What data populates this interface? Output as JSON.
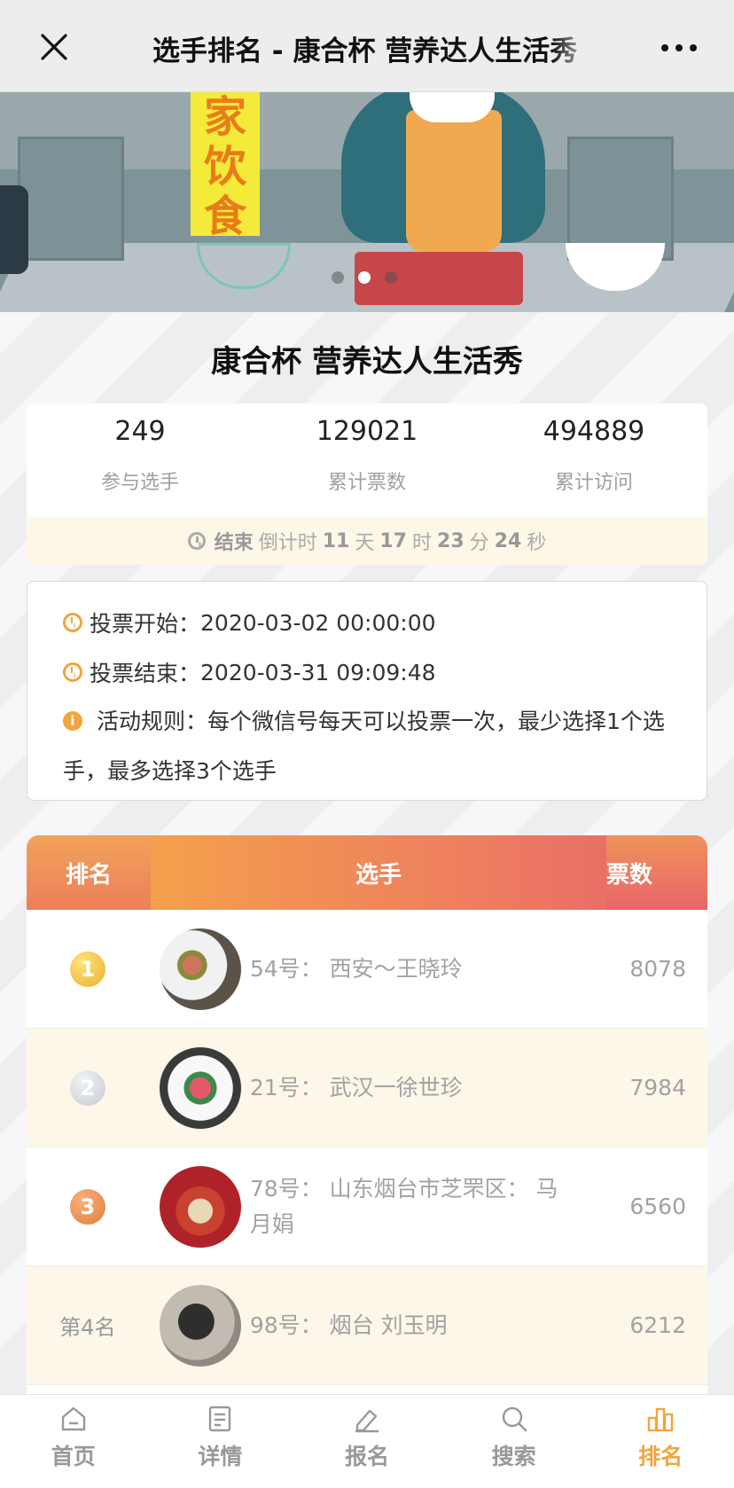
{
  "header": {
    "title": "选手排名 - 康合杯 营养达人生活秀",
    "close_icon": "close-icon",
    "more_icon": "more-dots-icon"
  },
  "banner": {
    "sign_text": [
      "家",
      "饮",
      "食"
    ],
    "slides_total": 3,
    "slide_active": 2
  },
  "activity": {
    "title": "康合杯 营养达人生活秀"
  },
  "stats": [
    {
      "value": "249",
      "label": "参与选手"
    },
    {
      "value": "129021",
      "label": "累计票数"
    },
    {
      "value": "494889",
      "label": "累计访问"
    }
  ],
  "countdown": {
    "status": "结束",
    "prefix": "倒计时",
    "days": "11",
    "days_unit": "天",
    "hours": "17",
    "hours_unit": "时",
    "minutes": "23",
    "minutes_unit": "分",
    "seconds": "24",
    "seconds_unit": "秒"
  },
  "info": {
    "start_label": "投票开始：",
    "start_value": "2020-03-02 00:00:00",
    "end_label": "投票结束：",
    "end_value": "2020-03-31 09:09:48",
    "rules_label": "活动规则：",
    "rules_value": "每个微信号每天可以投票一次，最少选择1个选手，最多选择3个选手"
  },
  "ranking": {
    "headers": {
      "rank": "排名",
      "player": "选手",
      "votes": "票数"
    },
    "rows": [
      {
        "rank": "1",
        "medal": "gold",
        "name": "54号：  西安～王晓玲",
        "votes": "8078"
      },
      {
        "rank": "2",
        "medal": "silver",
        "name": "21号：  武汉一徐世珍",
        "votes": "7984"
      },
      {
        "rank": "3",
        "medal": "bronze",
        "name": "78号：  山东烟台市芝罘区：  马月娟",
        "votes": "6560"
      },
      {
        "rank": "第4名",
        "medal": "",
        "name": "98号：  烟台 刘玉明",
        "votes": "6212"
      }
    ]
  },
  "tabs": [
    {
      "label": "首页",
      "icon": "home-icon",
      "active": false
    },
    {
      "label": "详情",
      "icon": "document-icon",
      "active": false
    },
    {
      "label": "报名",
      "icon": "edit-icon",
      "active": false
    },
    {
      "label": "搜索",
      "icon": "search-icon",
      "active": false
    },
    {
      "label": "排名",
      "icon": "ranking-icon",
      "active": true
    }
  ],
  "colors": {
    "accent": "#f1a53c",
    "header_gradient_start": "#f1a055",
    "header_gradient_end": "#e9606a",
    "alt_row": "#fdf7ea"
  }
}
